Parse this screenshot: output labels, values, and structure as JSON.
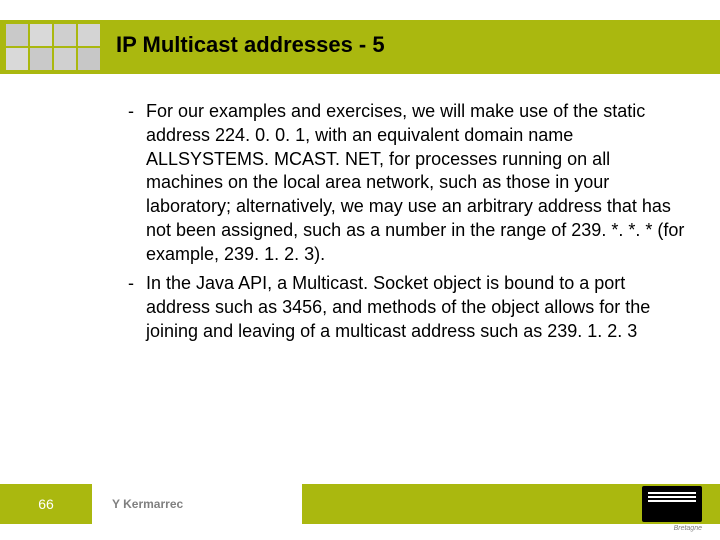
{
  "header": {
    "title": "IP Multicast addresses - 5"
  },
  "bullets": [
    "For our examples and exercises, we will make use of the static address 224. 0. 0. 1, with an equivalent domain name ALLSYSTEMS. MCAST. NET, for processes running on all machines on the local area network, such as those in your laboratory; alternatively, we may use an arbitrary address that has not been assigned, such as a number in the range of 239. *. *. * (for example, 239. 1. 2. 3).",
    "In the Java API, a Multicast. Socket object is bound to a port address such as 3456, and methods of the object allows for the joining and leaving of a multicast address such as 239. 1. 2. 3"
  ],
  "footer": {
    "page": "66",
    "author": "Y Kermarrec",
    "brand_sub": "Bretagne"
  }
}
